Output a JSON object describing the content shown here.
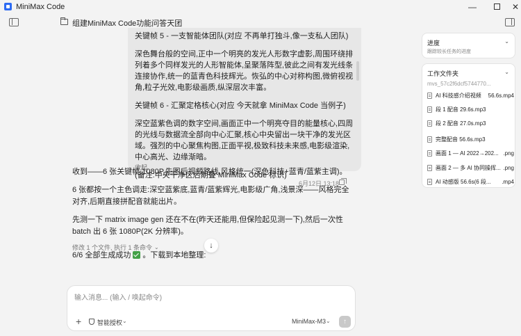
{
  "window": {
    "title": "MiniMax Code"
  },
  "header": {
    "thread_title": "组建MiniMax Code功能问答天团"
  },
  "user_message": {
    "paragraphs": [
      "关键帧 5 - 一支智能体团队(对应 不再单打独斗,像一支私人团队)",
      "深色舞台般的空间,正中一个明亮的发光人形数字虚影,周围环绕排列着多个同样发光的人形智能体,呈聚落阵型,彼此之间有发光线条连接协作,统一的蓝青色科技辉光。恢弘的中心对称构图,微俯视视角,粒子光效,电影级画质,纵深层次丰富。",
      "关键帧 6 - 汇聚定格核心(对应 今天就拿 MiniMax Code 当例子)",
      "深空蓝紫色调的数字空间,画面正中一个明亮夺目的能量核心,四周的光线与数据流全部向中心汇聚,核心中央留出一块干净的发光区域。强烈的中心聚焦构图,正面平视,极致科技未来感,电影级渲染,中心高光、边缘渐暗。",
      "(备注:中央干净区后期叠 MiniMax Code 标识)"
    ],
    "collapse_label": "收起",
    "timestamp": "6月12日,13:18"
  },
  "assistant_message": {
    "paragraphs": [
      "收到——6 张关键帧,1080P,先图后视频路线,风格统一(深色科技+蓝青/蓝紫主调)。",
      "6 张都按一个主色调走:深空蓝紫底,蓝青/蓝紫辉光,电影级广角,浅景深——风格完全对齐,后期直接拼配音就能出片。",
      "先测一下 matrix image gen 还在不在(昨天还能用,但保险起见测一下),然后一次性 batch 出 6 张 1080P(2K 分辨率)。"
    ],
    "files_changed": "修改 1 个文件, 执行 1 条命令",
    "done_before": "6/6 全部生成成功",
    "done_after": "。下载到本地整理:"
  },
  "composer": {
    "placeholder": "输入消息... (输入 / 唤起命令)",
    "permission_label": "智能授权",
    "model_label": "MiniMax-M3"
  },
  "panel": {
    "progress": {
      "title": "进度",
      "subtitle": "跟踪较长任务的进度"
    },
    "files": {
      "title": "工作文件夹",
      "folder": "mvs_57c2f6dcf5744770...",
      "items": [
        {
          "name": "AI 科技感介绍视频",
          "ext": "56.6s.mp4"
        },
        {
          "name": "段 1 配音 29.6s.mp3",
          "ext": ""
        },
        {
          "name": "段 2 配音 27.0s.mp3",
          "ext": ""
        },
        {
          "name": "完整配音 56.6s.mp3",
          "ext": ""
        },
        {
          "name": "画面 1 — AI 2022→202...",
          "ext": ".png"
        },
        {
          "name": "画面 2 — 多 AI 协同操挥...",
          "ext": ".png"
        },
        {
          "name": "AI 动感版 56.6s(6 段...",
          "ext": ".mp4"
        }
      ]
    }
  }
}
